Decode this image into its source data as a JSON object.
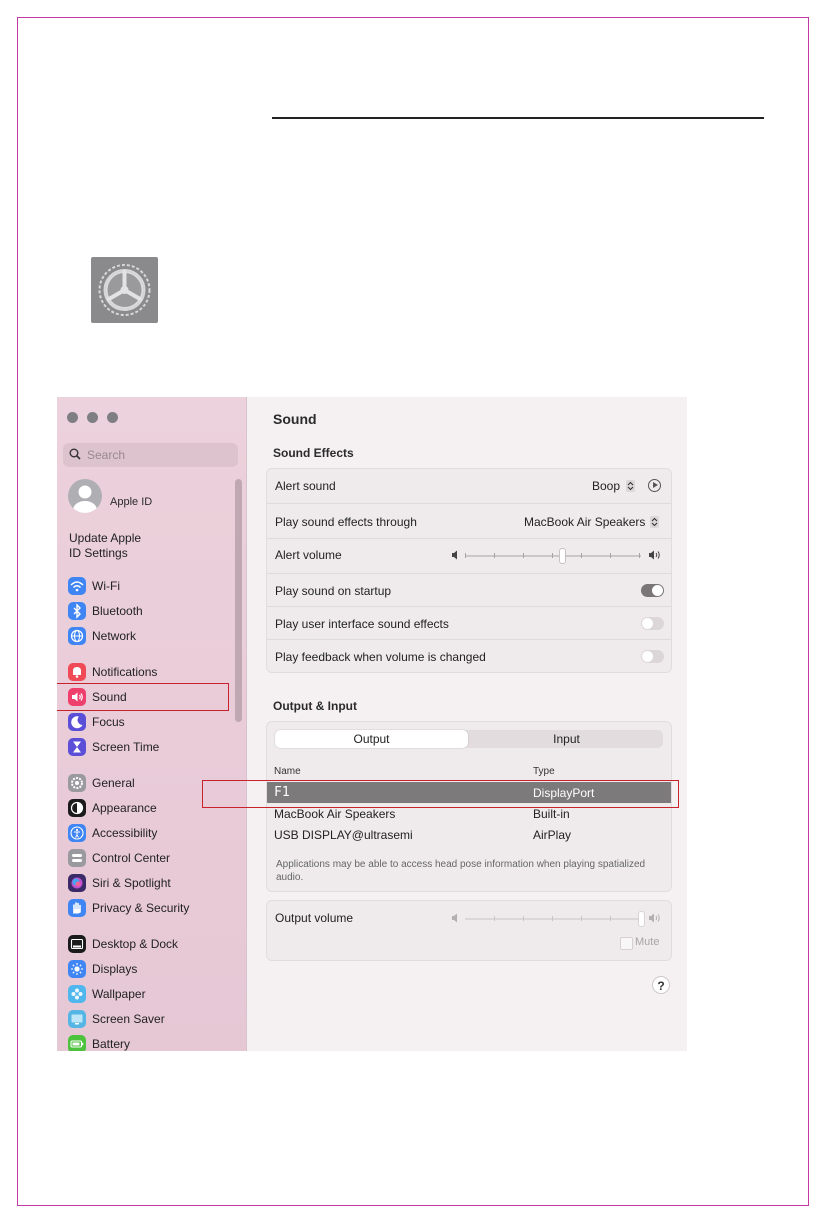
{
  "window": {
    "title": "Sound"
  },
  "sidebar": {
    "search_placeholder": "Search",
    "apple_id": "Apple ID",
    "update_line1": "Update Apple",
    "update_line2": "ID Settings",
    "items": [
      {
        "label": "Wi-Fi",
        "icon": "wifi-icon",
        "color": "#3f86f4"
      },
      {
        "label": "Bluetooth",
        "icon": "bluetooth-icon",
        "color": "#3f86f4"
      },
      {
        "label": "Network",
        "icon": "globe-icon",
        "color": "#3f86f4"
      },
      {
        "label": "Notifications",
        "icon": "bell-icon",
        "color": "#ef4a55"
      },
      {
        "label": "Sound",
        "icon": "speaker-icon",
        "color": "#ef3f6c"
      },
      {
        "label": "Focus",
        "icon": "moon-icon",
        "color": "#5b4fd8"
      },
      {
        "label": "Screen Time",
        "icon": "hourglass-icon",
        "color": "#5b4fd8"
      },
      {
        "label": "General",
        "icon": "gear-icon",
        "color": "#9a9a9e"
      },
      {
        "label": "Appearance",
        "icon": "appearance-icon",
        "color": "#1b1b1b"
      },
      {
        "label": "Accessibility",
        "icon": "accessibility-icon",
        "color": "#3f86f4"
      },
      {
        "label": "Control Center",
        "icon": "control-center-icon",
        "color": "#9a9a9e"
      },
      {
        "label": "Siri & Spotlight",
        "icon": "siri-icon",
        "color": "#3b2a68"
      },
      {
        "label": "Privacy & Security",
        "icon": "hand-icon",
        "color": "#3f86f4"
      },
      {
        "label": "Desktop & Dock",
        "icon": "dock-icon",
        "color": "#1b1b1b"
      },
      {
        "label": "Displays",
        "icon": "sun-icon",
        "color": "#3f86f4"
      },
      {
        "label": "Wallpaper",
        "icon": "flower-icon",
        "color": "#4fb7ee"
      },
      {
        "label": "Screen Saver",
        "icon": "screen-saver-icon",
        "color": "#55b6e6"
      },
      {
        "label": "Battery",
        "icon": "battery-icon",
        "color": "#4cc23d"
      }
    ],
    "selected": "Sound"
  },
  "sound_effects": {
    "heading": "Sound Effects",
    "alert_sound_label": "Alert sound",
    "alert_sound_value": "Boop",
    "play_through_label": "Play sound effects through",
    "play_through_value": "MacBook Air Speakers",
    "alert_volume_label": "Alert volume",
    "alert_volume_level": 0.55,
    "startup_label": "Play sound on startup",
    "startup_on": true,
    "ui_effects_label": "Play user interface sound effects",
    "ui_effects_on": false,
    "feedback_label": "Play feedback when volume is changed",
    "feedback_on": false
  },
  "output_input": {
    "heading": "Output & Input",
    "tabs": [
      "Output",
      "Input"
    ],
    "active_tab": "Output",
    "col_name": "Name",
    "col_type": "Type",
    "devices": [
      {
        "name": "F1",
        "type": "DisplayPort",
        "selected": true
      },
      {
        "name": "MacBook Air Speakers",
        "type": "Built-in",
        "selected": false
      },
      {
        "name": "USB DISPLAY@ultrasemi",
        "type": "AirPlay",
        "selected": false
      }
    ],
    "note": "Applications may be able to access head pose information when playing spatialized audio.",
    "output_volume_label": "Output volume",
    "output_volume_level": 1.0,
    "mute_label": "Mute",
    "help": "?"
  },
  "colors": {
    "highlight_border": "#c8232c",
    "toggle_on": "#7a7678",
    "toggle_off": "#dcd6d8"
  }
}
